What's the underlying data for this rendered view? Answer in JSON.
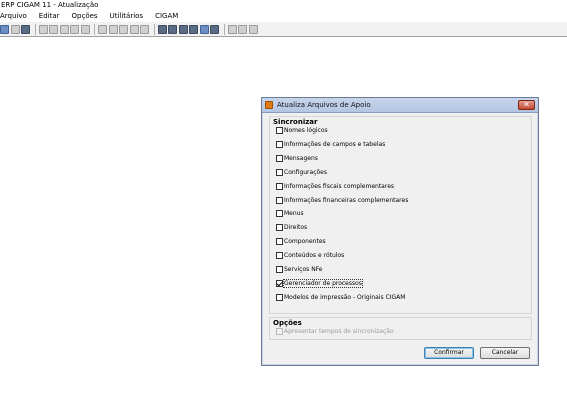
{
  "app": {
    "title": "ERP CIGAM 11 - Atualização"
  },
  "menu": [
    "Arquivo",
    "Editar",
    "Opções",
    "Utilitários",
    "CIGAM"
  ],
  "dialog": {
    "title": "Atualiza Arquivos de Apoio",
    "sync_group_label": "Sincronizar",
    "sync_items": [
      {
        "label": "Nomes lógicos",
        "checked": false
      },
      {
        "label": "Informações de campos e tabelas",
        "checked": false
      },
      {
        "label": "Mensagens",
        "checked": false
      },
      {
        "label": "Configurações",
        "checked": false
      },
      {
        "label": "Informações fiscais complementares",
        "checked": false
      },
      {
        "label": "Informações financeiras complementares",
        "checked": false
      },
      {
        "label": "Menus",
        "checked": false
      },
      {
        "label": "Direitos",
        "checked": false
      },
      {
        "label": "Componentes",
        "checked": false
      },
      {
        "label": "Conteúdos e rótulos",
        "checked": false
      },
      {
        "label": "Serviços NFe",
        "checked": false
      },
      {
        "label": "Gerenciador de processos",
        "checked": true
      },
      {
        "label": "Modelos de impressão - Originais CIGAM",
        "checked": false
      }
    ],
    "options_group_label": "Opções",
    "option_items": [
      {
        "label": "Apresentar tempos de sincronização",
        "checked": false,
        "disabled": true
      }
    ],
    "confirm_label": "Confirmar",
    "cancel_label": "Cancelar",
    "close_glyph": "✕"
  }
}
